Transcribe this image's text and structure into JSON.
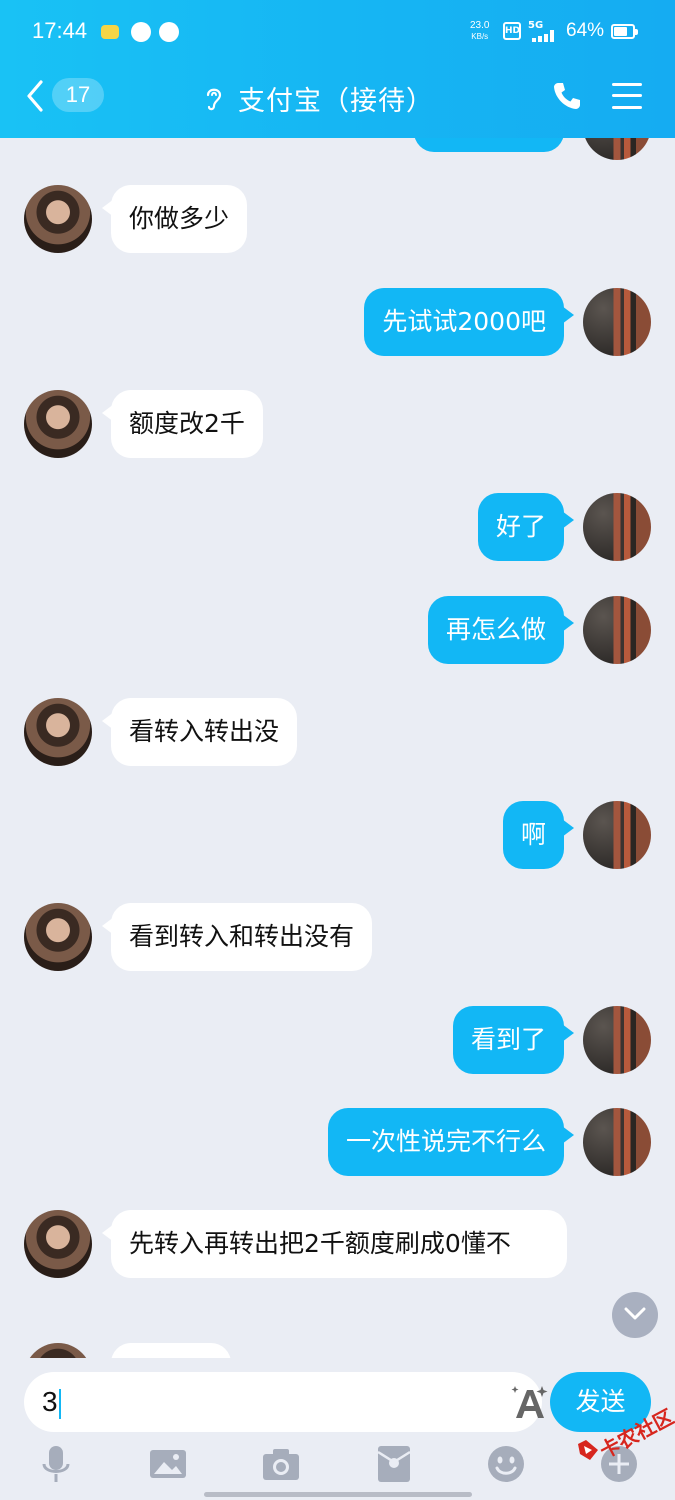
{
  "status_bar": {
    "time": "17:44",
    "net_speed_value": "23.0",
    "net_speed_unit": "KB/s",
    "hd": "HD",
    "signal": "5G",
    "battery": "64%"
  },
  "header": {
    "unread_count": "17",
    "title": "支付宝（接待）"
  },
  "messages": [
    {
      "from": "peer",
      "text": "你做多少"
    },
    {
      "from": "me",
      "text": "先试试2000吧"
    },
    {
      "from": "peer",
      "text": "额度改2千"
    },
    {
      "from": "me",
      "text": "好了"
    },
    {
      "from": "me",
      "text": "再怎么做"
    },
    {
      "from": "peer",
      "text": "看转入转出没"
    },
    {
      "from": "me",
      "text": "啊"
    },
    {
      "from": "peer",
      "text": "看到转入和转出没有"
    },
    {
      "from": "me",
      "text": "看到了"
    },
    {
      "from": "me",
      "text": "一次性说完不行么"
    },
    {
      "from": "peer",
      "text": "先转入再转出把2千额度刷成0懂不"
    }
  ],
  "input": {
    "value": "3",
    "send_label": "发送"
  },
  "toolbar": [
    "microphone-icon",
    "image-icon",
    "camera-icon",
    "red-packet-icon",
    "emoji-icon",
    "plus-icon"
  ],
  "watermark": {
    "text": "卡农社区"
  },
  "colors": {
    "accent": "#12b7f5",
    "background": "#eaedf4",
    "peer_bubble": "#ffffff"
  }
}
